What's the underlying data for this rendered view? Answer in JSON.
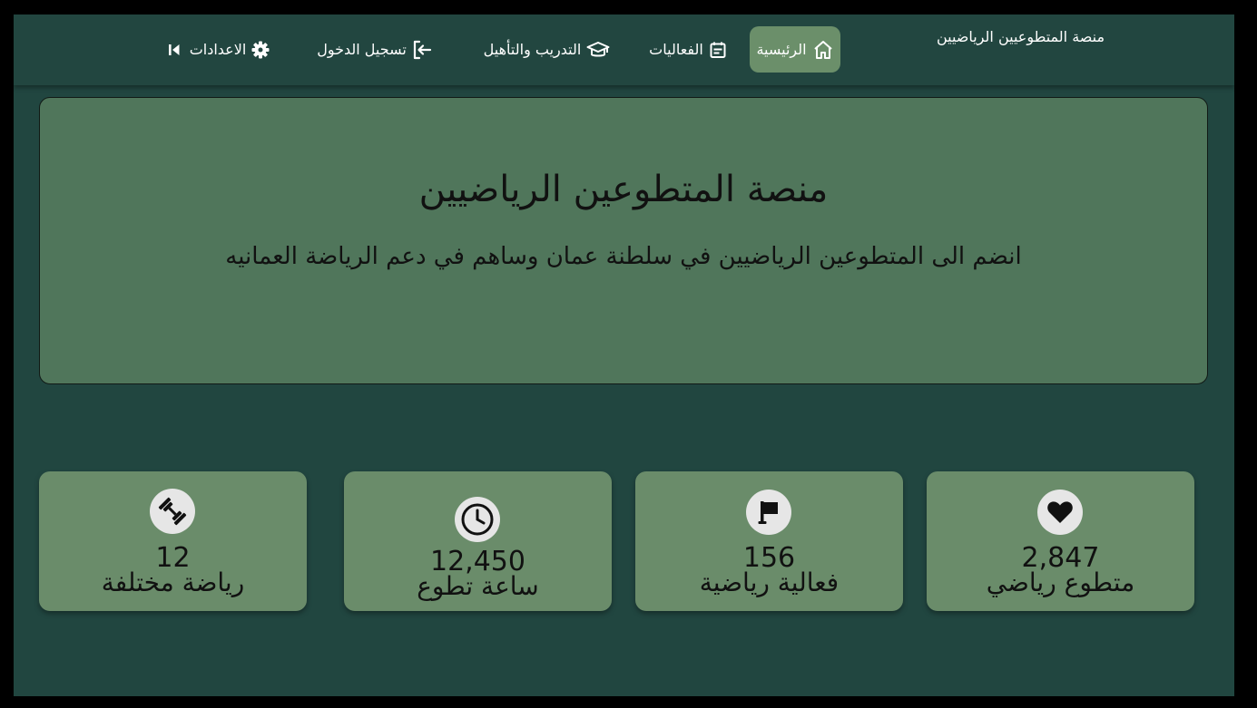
{
  "nav": {
    "brand": "منصة المتطوعيين الرياضيين",
    "items": [
      {
        "label": "الرئيسية",
        "icon": "home-icon",
        "active": true
      },
      {
        "label": "الفعاليات",
        "icon": "calendar-icon",
        "active": false
      },
      {
        "label": "التدريب والتأهيل",
        "icon": "graduation-cap-icon",
        "active": false
      },
      {
        "label": "تسجيل الدخول",
        "icon": "sign-in-icon",
        "active": false
      },
      {
        "label": "الاعدادات",
        "icon": "gear-icon",
        "active": false
      }
    ],
    "collapse_icon": "collapse-left-icon"
  },
  "hero": {
    "title": "منصة المتطوعين الرياضيين",
    "subtitle": "انضم الى المتطوعين الرياضيين في سلطنة عمان وساهم في دعم الرياضة العمانيه"
  },
  "stats": [
    {
      "value": "2,847",
      "label": "متطوع رياضي",
      "icon": "heart-icon"
    },
    {
      "value": "156",
      "label": "فعالية رياضية",
      "icon": "flag-icon"
    },
    {
      "value": "12,450",
      "label": "ساعة تطوع",
      "icon": "clock-icon"
    },
    {
      "value": "12",
      "label": "رياضة مختلفة",
      "icon": "dumbbell-icon"
    }
  ],
  "colors": {
    "page_bg": "#214640",
    "nav_active_bg": "#6b8f6a",
    "hero_bg": "#50765b",
    "card_bg": "#6a8c6a",
    "icon_circle_bg": "#e6e6e6"
  }
}
